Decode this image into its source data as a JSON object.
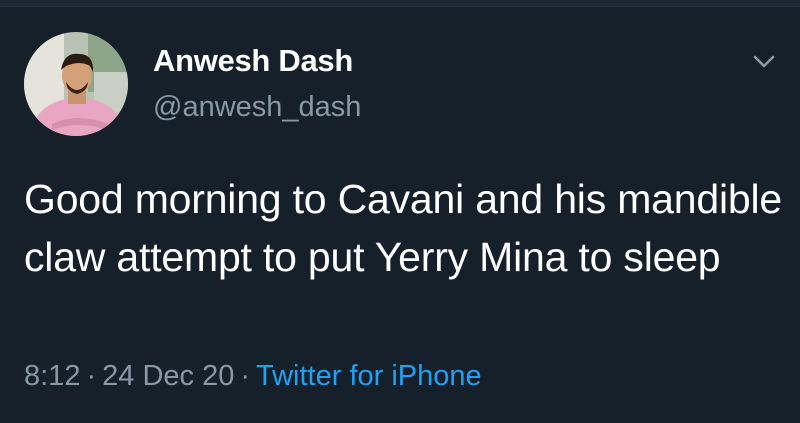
{
  "tweet": {
    "author": {
      "display_name": "Anwesh Dash",
      "handle": "@anwesh_dash",
      "avatar_icon": "user-avatar-photo"
    },
    "menu_icon": "chevron-down-icon",
    "text": "Good morning to Cavani and his mandible claw attempt to put Yerry Mina to sleep",
    "time": "8:12",
    "date": "24 Dec 20",
    "separator": "·",
    "source": "Twitter for iPhone"
  },
  "colors": {
    "background": "#15202b",
    "primary_text": "#ffffff",
    "secondary_text": "#8899a6",
    "accent": "#1da1f2"
  }
}
